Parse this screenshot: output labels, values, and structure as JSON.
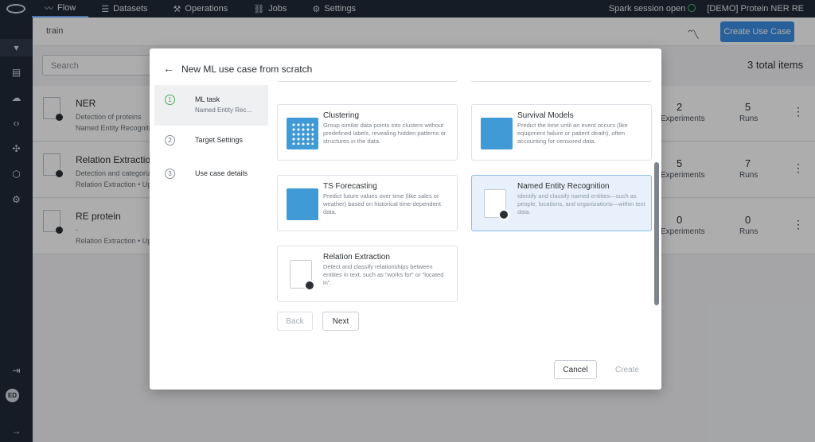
{
  "nav": {
    "items": [
      {
        "icon": "〰",
        "label": "Flow",
        "active": true
      },
      {
        "icon": "☰",
        "label": "Datasets",
        "active": false
      },
      {
        "icon": "⚒",
        "label": "Operations",
        "active": false
      },
      {
        "icon": "⛓",
        "label": "Jobs",
        "active": false
      },
      {
        "icon": "⚙",
        "label": "Settings",
        "active": false
      }
    ],
    "spark_status": "Spark session open",
    "project": "[DEMO] Protein NER RE"
  },
  "rail": {
    "icons": [
      "▾",
      "▤",
      "☁",
      "‹›",
      "✣",
      "⬡",
      "⚙"
    ],
    "logout": "⇥",
    "avatar": "ED",
    "expand": "→"
  },
  "page": {
    "breadcrumb": "train",
    "create_button": "Create Use Case",
    "search_placeholder": "Search",
    "total_items": "3 total items",
    "rows": [
      {
        "title": "NER",
        "desc": "Detection of proteins",
        "sub": "Named Entity Recognitio",
        "experiments": "2",
        "runs": "5"
      },
      {
        "title": "Relation Extraction",
        "desc": "Detection and categoriz",
        "sub": "Relation Extraction • Up",
        "experiments": "5",
        "runs": "7"
      },
      {
        "title": "RE protein",
        "desc": "-",
        "sub": "Relation Extraction • Up",
        "experiments": "0",
        "runs": "0"
      }
    ],
    "experiments_label": "Experiments",
    "runs_label": "Runs"
  },
  "modal": {
    "title": "New ML use case from scratch",
    "steps": [
      {
        "num": "1",
        "label": "ML task",
        "sub": "Named Entity Rec..."
      },
      {
        "num": "2",
        "label": "Target Settings",
        "sub": ""
      },
      {
        "num": "3",
        "label": "Use case details",
        "sub": ""
      }
    ],
    "cards": [
      {
        "title": "Clustering",
        "desc": "Group similar data points into clusters without predefined labels, revealing hidden patterns or structures in the data."
      },
      {
        "title": "Survival Models",
        "desc": "Predict the time until an event occurs (like equipment failure or patient death), often accounting for censored data."
      },
      {
        "title": "TS Forecasting",
        "desc": "Predict future values over time (like sales or weather) based on historical time-dependent data."
      },
      {
        "title": "Named Entity Recognition",
        "desc": "Identify and classify named entities—such as people, locations, and organizations—within text data."
      },
      {
        "title": "Relation Extraction",
        "desc": "Detect and classify relationships between entities in text, such as \"works for\" or \"located in\"."
      }
    ],
    "back": "Back",
    "next": "Next",
    "cancel": "Cancel",
    "create": "Create"
  }
}
